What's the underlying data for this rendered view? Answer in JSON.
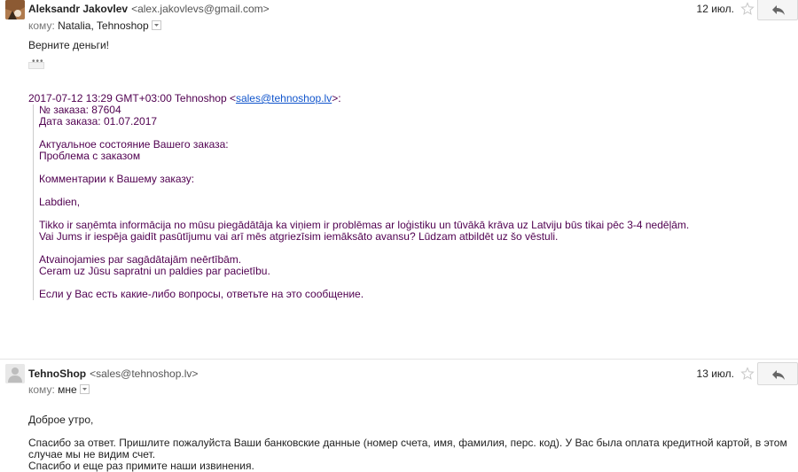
{
  "message1": {
    "sender_name": "Aleksandr Jakovlev",
    "sender_email": "<alex.jakovlevs@gmail.com>",
    "to_label": "кому:",
    "to_names": "Natalia, Tehnoshop",
    "date": "12 июл.",
    "body": "Верните деньги!",
    "quote_header_prefix": "2017-07-12 13:29 GMT+03:00 Tehnoshop <",
    "quote_email": "sales@tehnoshop.lv",
    "quote_header_suffix": ">:",
    "quoted_lines": [
      "№ заказа: 87604",
      "Дата заказа: 01.07.2017",
      "Актуальное состояние Вашего заказа:",
      "Проблема с заказом",
      "Комментарии к Вашему заказу:",
      "Labdien,",
      "Tikko ir saņēmta informācija no mūsu piegādātāja ka viņiem ir problēmas ar loģistiku un tūvākā krāva uz Latviju būs tikai pēc 3-4 nedēļām.",
      "Vai Jums ir iespēja gaidīt pasūtījumu vai arī mēs atgriezīsim iemāksāto avansu? Lūdzam atbildēt uz šo vēstuli.",
      "Atvainojamies par sagādātajām neērtībām.",
      "Ceram uz Jūsu sapratni un paldies par pacietību.",
      "Если у Вас есть какие-либо вопросы, ответьте на это сообщение."
    ]
  },
  "message2": {
    "sender_name": "TehnoShop",
    "sender_email": "<sales@tehnoshop.lv>",
    "to_label": "кому:",
    "to_names": "мне",
    "date": "13 июл.",
    "body_lines": [
      "Доброе утро,",
      "Спасибо за ответ. Пришлите пожалуйста Ваши банковские данные (номер счета, имя, фамилия, перс. код). У Вас была оплата кредитной картой, в этом случае мы не видим счет.",
      "Спасибо и еще раз примите наши извинения."
    ]
  },
  "icons": {
    "star": "star-outline-icon",
    "reply": "reply-arrow-icon",
    "details": "chevron-down-icon",
    "avatar": "person-avatar-icon"
  },
  "colors": {
    "quote_text": "#500050",
    "link": "#1155cc",
    "button_bg": "#f5f5f5"
  }
}
